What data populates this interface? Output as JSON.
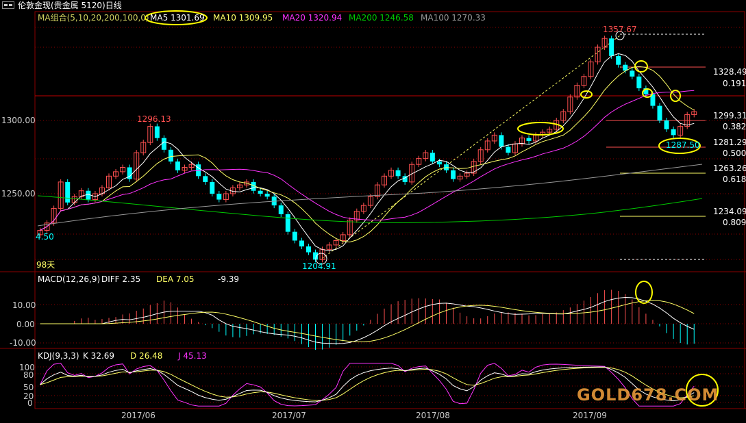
{
  "window": {
    "title": "伦敦金现(贵金属 5120)日线"
  },
  "main_panel": {
    "indicator_name": "MA组合(5,10,20,200,100,0)",
    "ma5": "MA5 1301.69",
    "ma10": "MA10 1309.95",
    "ma20": "MA20 1320.94",
    "ma200": "MA200 1246.58",
    "ma100": "MA100 1270.33",
    "y_ticks": [
      "1300.00",
      "1250.00"
    ],
    "left_value": "4.50",
    "days_label": "98天",
    "price_labels": {
      "high_main": "1357.67",
      "high_left": "1296.13",
      "low": "1204.91",
      "recent_low": "1287.50"
    },
    "fib_levels": [
      {
        "price": "1328.49",
        "ratio": "0.191"
      },
      {
        "price": "1299.31",
        "ratio": "0.382"
      },
      {
        "price": "1281.29",
        "ratio": "0.500"
      },
      {
        "price": "1263.26",
        "ratio": "0.618"
      },
      {
        "price": "1234.09",
        "ratio": "0.809"
      }
    ]
  },
  "macd_panel": {
    "name": "MACD(12,26,9)",
    "diff": "DIFF  2.35",
    "dea": "DEA  7.05",
    "macd": "-9.39",
    "y_ticks": [
      "10.00",
      "0.00",
      "-10.00"
    ]
  },
  "kdj_panel": {
    "name": "KDJ(9,3,3)",
    "k": "K  32.69",
    "d": "D  26.48",
    "j": "J  45.13",
    "y_ticks": [
      "100",
      "80",
      "50",
      "20",
      "0"
    ]
  },
  "x_axis": {
    "ticks": [
      "2017/06",
      "2017/07",
      "2017/08",
      "2017/09"
    ]
  },
  "watermark": {
    "text": "GOLD678.COM"
  },
  "colors": {
    "up": "#ff5050",
    "down": "#00ffff",
    "ma5": "#ffffff",
    "ma10": "#ffff66",
    "ma20": "#ff33ff",
    "ma200": "#00cc00",
    "ma100": "#999999",
    "grid": "#8b0000",
    "highlight": "#ffff00"
  }
}
